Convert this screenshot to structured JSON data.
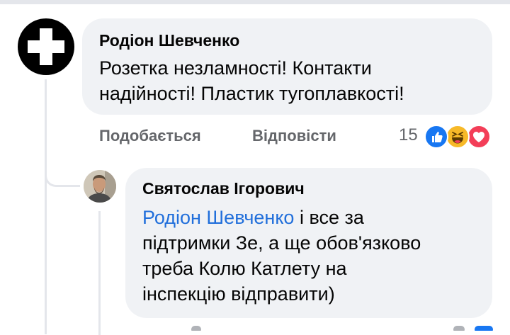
{
  "comment": {
    "author": "Родіон Шевченко",
    "text_line1": "Розетка незламності! Контакти",
    "text_line2": "надійності! Пластик тугоплавкості!",
    "actions": {
      "like_label": "Подобається",
      "reply_label": "Відповісти"
    },
    "reactions": {
      "count": "15",
      "types": [
        "like-icon",
        "haha-icon",
        "love-icon"
      ],
      "colors": {
        "like": "#1877f2",
        "haha": "#f7b928",
        "love": "#f33e58"
      }
    }
  },
  "reply": {
    "author": "Святослав Ігорович",
    "mention": "Родіон Шевченко",
    "text_line1_rest": " і все за",
    "text_line2": "підтримки Зе, а ще обов'язково",
    "text_line3": "треба Колю Катлету на",
    "text_line4": "інспекцію відправити)"
  },
  "colors": {
    "bubble_bg": "#f0f2f5",
    "secondary_text": "#65676b",
    "link": "#216fdb",
    "thread_line": "#e4e6eb"
  }
}
